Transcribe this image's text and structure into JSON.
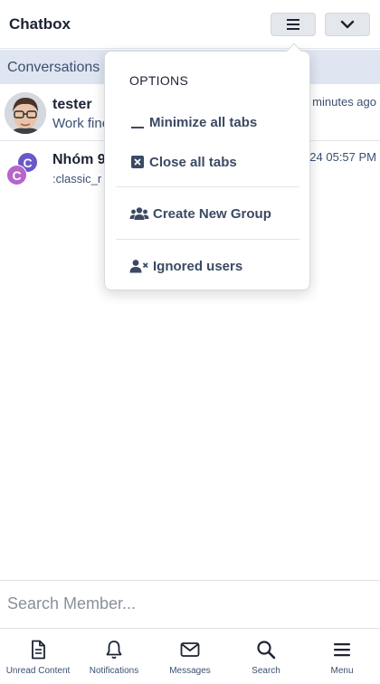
{
  "header": {
    "title": "Chatbox",
    "menu_icon": "hamburger-icon",
    "collapse_icon": "chevron-down-icon"
  },
  "conversations": {
    "label": "Conversations",
    "items": [
      {
        "name": "tester",
        "snippet": "Work fine",
        "time": "minutes ago",
        "avatar": "user-photo"
      },
      {
        "name": "Nhóm 9",
        "snippet": ":classic_r",
        "time": "/24 05:57 PM",
        "avatar_letters": [
          "C",
          "C"
        ]
      }
    ]
  },
  "dropdown": {
    "heading": "OPTIONS",
    "items": [
      {
        "label": "Minimize all tabs",
        "icon": "minimize-icon"
      },
      {
        "label": "Close all tabs",
        "icon": "close-box-icon"
      },
      {
        "label": "Create New Group",
        "icon": "users-icon"
      },
      {
        "label": "Ignored users",
        "icon": "user-ignore-icon"
      }
    ]
  },
  "search": {
    "placeholder": "Search Member..."
  },
  "bottom_nav": [
    {
      "label": "Unread Content",
      "icon": "document-icon"
    },
    {
      "label": "Notifications",
      "icon": "bell-icon"
    },
    {
      "label": "Messages",
      "icon": "envelope-icon"
    },
    {
      "label": "Search",
      "icon": "search-icon"
    },
    {
      "label": "Menu",
      "icon": "menu-icon"
    }
  ],
  "colors": {
    "accent": "#3b5070",
    "conversation_bar": "#dfe6f1",
    "avatar_purple": "#6b57c8",
    "avatar_pink": "#b665c9"
  }
}
